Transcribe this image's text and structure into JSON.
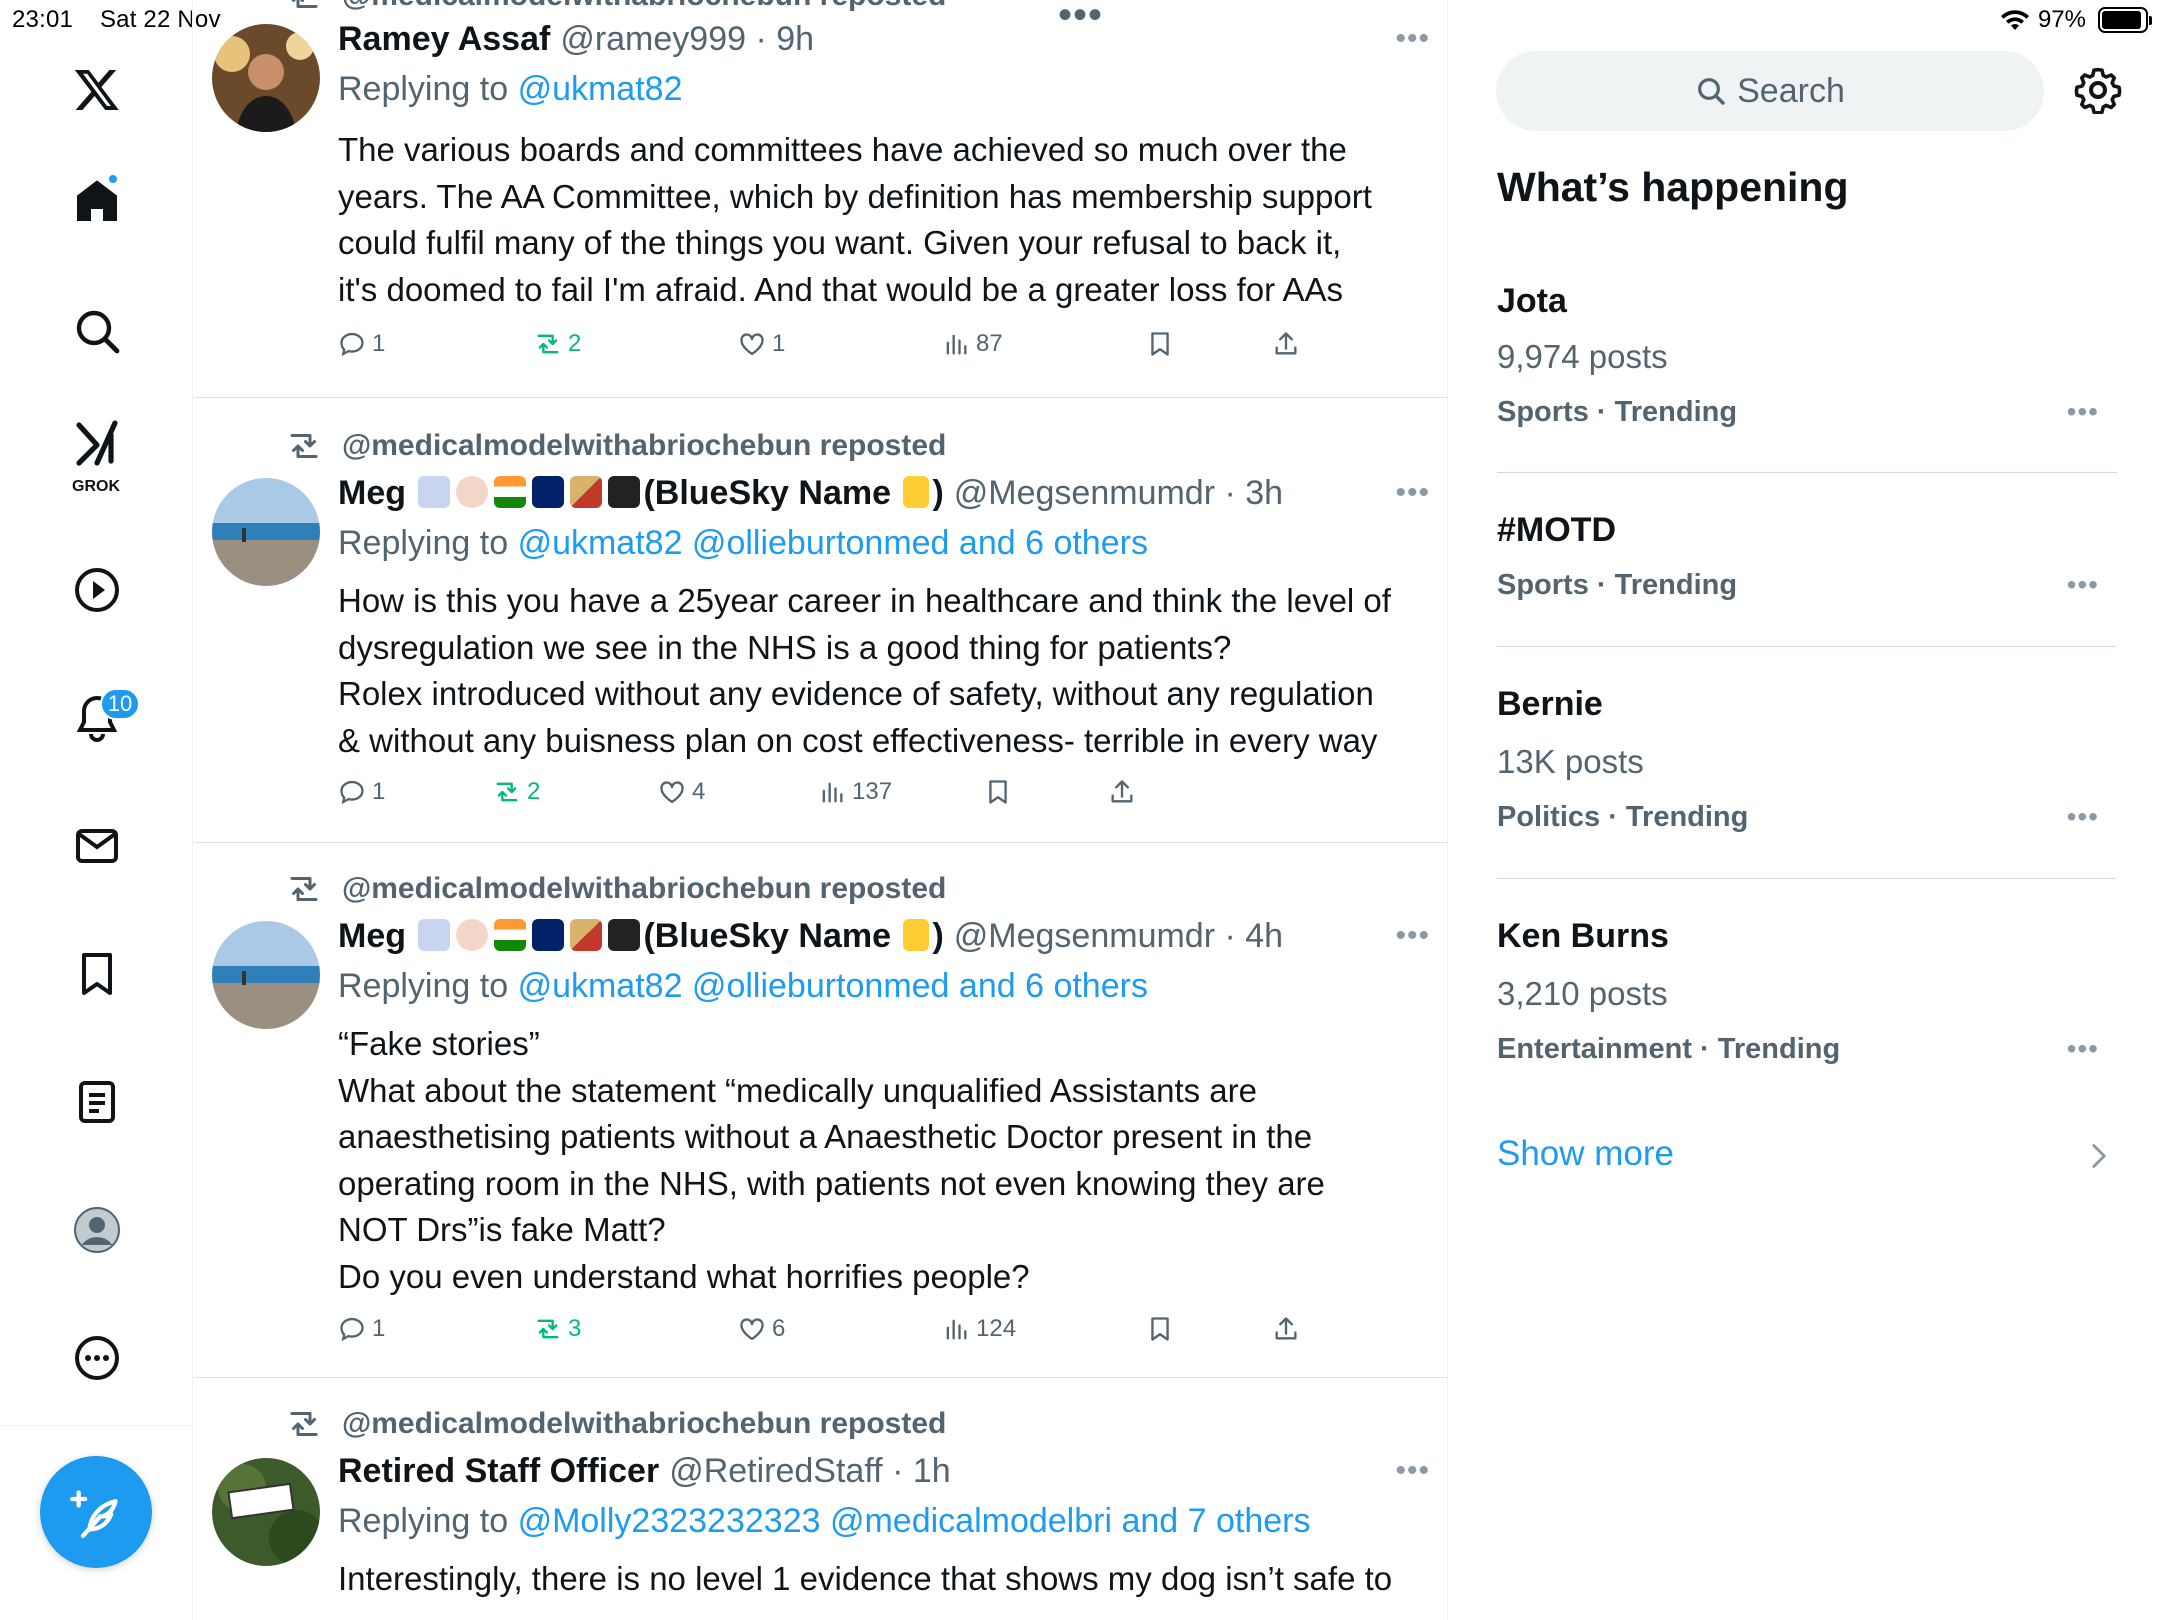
{
  "status": {
    "time": "23:01",
    "date": "Sat 22 Nov",
    "battery": "97%"
  },
  "top_hidden_repost": "@medicalmodelwithabriochebun reposted",
  "nav": {
    "grok_label": "GROK",
    "notifications_badge": "10"
  },
  "tweets": [
    {
      "name": "Ramey Assaf",
      "handle": "@ramey999 · 9h",
      "replying_prefix": "Replying to",
      "mentions": "@ukmat82",
      "body": [
        "The various boards and committees have achieved so much over the",
        "years. The AA Committee, which by definition has membership support",
        "could fulfil many of the things you want. Given your refusal to back it,",
        "it's doomed to fail I'm afraid. And that would be a greater loss for AAs"
      ],
      "replies": "1",
      "reposts": "2",
      "likes": "1",
      "views": "87"
    },
    {
      "repost_label": "@medicalmodelwithabriochebun reposted",
      "name_prefix": "Meg",
      "name_suffix": "(BlueSky Name",
      "name_end": ")",
      "handle": "@Megsenmumdr · 3h",
      "replying_prefix": "Replying to",
      "mentions": "@ukmat82 @ollieburtonmed and 6 others",
      "body": [
        "How is this you have a 25year career in healthcare and think the level of",
        "dysregulation we see in the NHS is a good thing for patients?",
        "Rolex introduced without any evidence of safety, without any regulation",
        "& without any buisness plan on cost effectiveness- terrible in every way"
      ],
      "replies": "1",
      "reposts": "2",
      "likes": "4",
      "views": "137"
    },
    {
      "repost_label": "@medicalmodelwithabriochebun reposted",
      "name_prefix": "Meg",
      "name_suffix": "(BlueSky Name",
      "name_end": ")",
      "handle": "@Megsenmumdr · 4h",
      "replying_prefix": "Replying to",
      "mentions": "@ukmat82 @ollieburtonmed and 6 others",
      "body": [
        "“Fake stories”",
        "What about the statement “medically unqualified Assistants are",
        "anaesthetising patients without a Anaesthetic Doctor present in the",
        "operating room in the NHS, with patients not even knowing they are",
        "NOT Drs”is fake Matt?",
        "Do you even understand what horrifies people?"
      ],
      "replies": "1",
      "reposts": "3",
      "likes": "6",
      "views": "124"
    },
    {
      "repost_label": "@medicalmodelwithabriochebun reposted",
      "name": "Retired Staff Officer",
      "handle": "@RetiredStaff · 1h",
      "replying_prefix": "Replying to",
      "mentions": "@Molly2323232323 @medicalmodelbri and 7 others",
      "body": [
        "Interestingly, there is no level 1 evidence that shows my dog isn’t safe to"
      ]
    }
  ],
  "right": {
    "search_placeholder": "Search",
    "title": "What’s happening",
    "trends": [
      {
        "name": "Jota",
        "posts": "9,974 posts",
        "category": "Sports · Trending"
      },
      {
        "name": "#MOTD",
        "posts": "",
        "category": "Sports · Trending"
      },
      {
        "name": "Bernie",
        "posts": "13K posts",
        "category": "Politics · Trending"
      },
      {
        "name": "Ken Burns",
        "posts": "3,210 posts",
        "category": "Entertainment · Trending"
      }
    ],
    "show_more": "Show more"
  },
  "colors": {
    "accent": "#1d9bf0",
    "repost_green": "#00ba7c",
    "muted": "#536471"
  },
  "icons": [
    "x-logo-icon",
    "home-icon",
    "search-icon",
    "grok-icon",
    "video-icon",
    "bell-icon",
    "mail-icon",
    "bookmark-icon",
    "list-icon",
    "profile-icon",
    "more-icon",
    "compose-icon",
    "gear-icon"
  ]
}
